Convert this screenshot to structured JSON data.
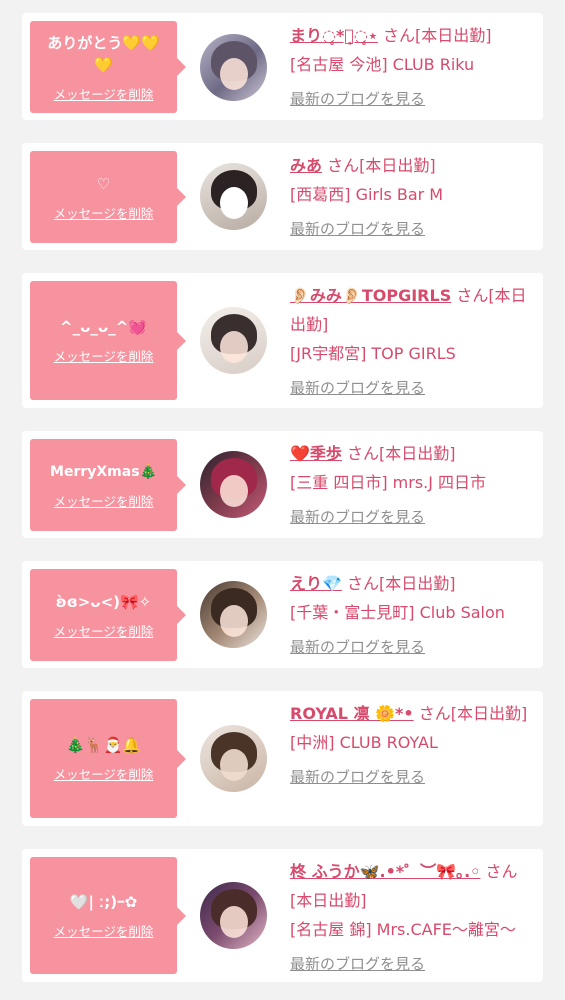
{
  "delete_label": "メッセージを削除",
  "san_label": "さん[本日出勤]",
  "blog_label": "最新のブログを見る",
  "cards": [
    {
      "message": "ありがとう💛💛💛",
      "name": "まり◌̥*⃝̣◌̥⋆",
      "shop": "[名古屋 今池] CLUB Riku"
    },
    {
      "message": "♡",
      "name": "みあ",
      "shop": "[西葛西] Girls Bar M"
    },
    {
      "message": "^_ᴗ_ᴗ_^💓",
      "name": "👂🏻みみ👂🏻TOPGIRLS",
      "shop": "[JR宇都宮] TOP GIRLS"
    },
    {
      "message": "MerryXmas🎄",
      "name": "❤️季歩",
      "shop": "[三重 四日市] mrs.J 四日市"
    },
    {
      "message": "ʚ̀ɞ>ᴗ<)🎀✧",
      "name": "えり💎",
      "shop": "[千葉・富士見町] Club Salon"
    },
    {
      "message": "🎄🦌🎅🔔",
      "name": "ROYAL 凛 🌼*•",
      "shop": "[中洲] CLUB ROYAL"
    },
    {
      "message": "🤍| ː;)ｰ✿",
      "name": "柊 ふうか🦋.•*゜︶🎀｡.◦",
      "shop": "[名古屋 錦] Mrs.CAFE〜離宮〜"
    }
  ],
  "colors": {
    "accent": "#d84a6c",
    "bubble": "#f7929f",
    "link_gray": "#8f8f8f",
    "background": "#f2f2f3"
  }
}
